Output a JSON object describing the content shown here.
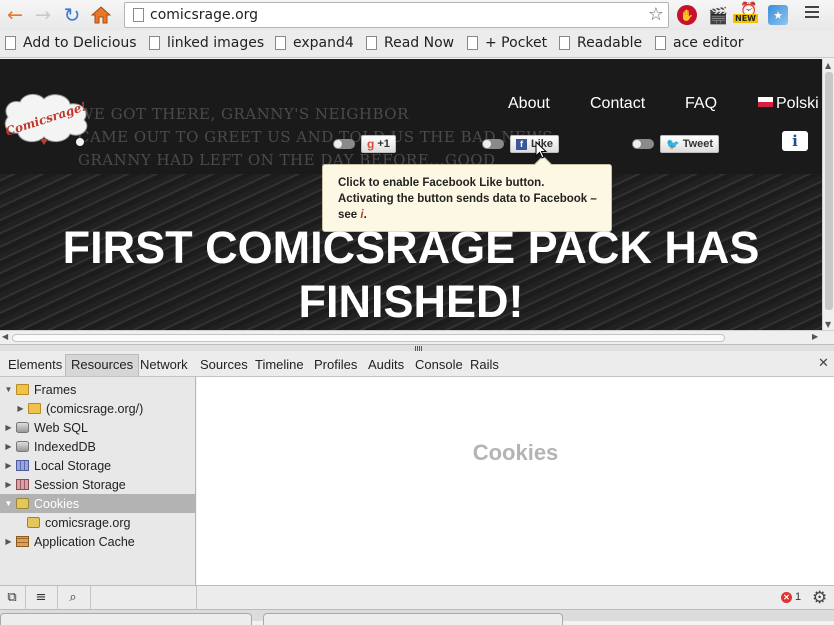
{
  "browser": {
    "url": "comicsrage.org",
    "bookmarks": [
      "Add to Delicious",
      "linked images",
      "expand4",
      "Read Now",
      "+ Pocket",
      "Readable",
      "ace editor"
    ],
    "extension_new_badge": "NEW"
  },
  "site": {
    "comic_text_lines": [
      "WE GOT THERE, GRANNY'S NEIGHBOR",
      "CAME OUT TO GREET US AND TOLD US THE BAD NEWS.",
      "GRANNY HAD LEFT ON THE DAY BEFORE...GOOD"
    ],
    "nav": {
      "about": "About",
      "contact": "Contact",
      "faq": "FAQ",
      "language": "Polski"
    },
    "social": {
      "gplus": "+1",
      "like": "Like",
      "tweet": "Tweet"
    },
    "info_label": "i",
    "tooltip": {
      "text": "Click to enable Facebook Like button. Activating the button sends data to Facebook – see ",
      "link": "i",
      "end": "."
    },
    "headline": "FIRST COMICSRAGE PACK HAS FINISHED!"
  },
  "devtools": {
    "tabs": [
      "Elements",
      "Resources",
      "Network",
      "Sources",
      "Timeline",
      "Profiles",
      "Audits",
      "Console",
      "Rails"
    ],
    "active_tab": "Resources",
    "tree": [
      {
        "label": "Frames",
        "icon": "folder-icon",
        "expanded": true
      },
      {
        "label": "(comicsrage.org/)",
        "icon": "folder-icon",
        "expanded": false
      },
      {
        "label": "Web SQL",
        "icon": "database-icon"
      },
      {
        "label": "IndexedDB",
        "icon": "database-icon"
      },
      {
        "label": "Local Storage",
        "icon": "storage-grid-icon"
      },
      {
        "label": "Session Storage",
        "icon": "storage-grid-icon"
      },
      {
        "label": "Cookies",
        "icon": "cookie-icon",
        "expanded": true,
        "selected": true
      },
      {
        "label": "comicsrage.org",
        "icon": "cookie-icon"
      },
      {
        "label": "Application Cache",
        "icon": "cache-icon"
      }
    ],
    "main_placeholder": "Cookies",
    "error_count": "1"
  },
  "colors": {
    "accent_orange": "#e8762b",
    "selected_row": "#b3b3b3",
    "tooltip_bg": "#fcf8e3",
    "error_red": "#d33"
  }
}
